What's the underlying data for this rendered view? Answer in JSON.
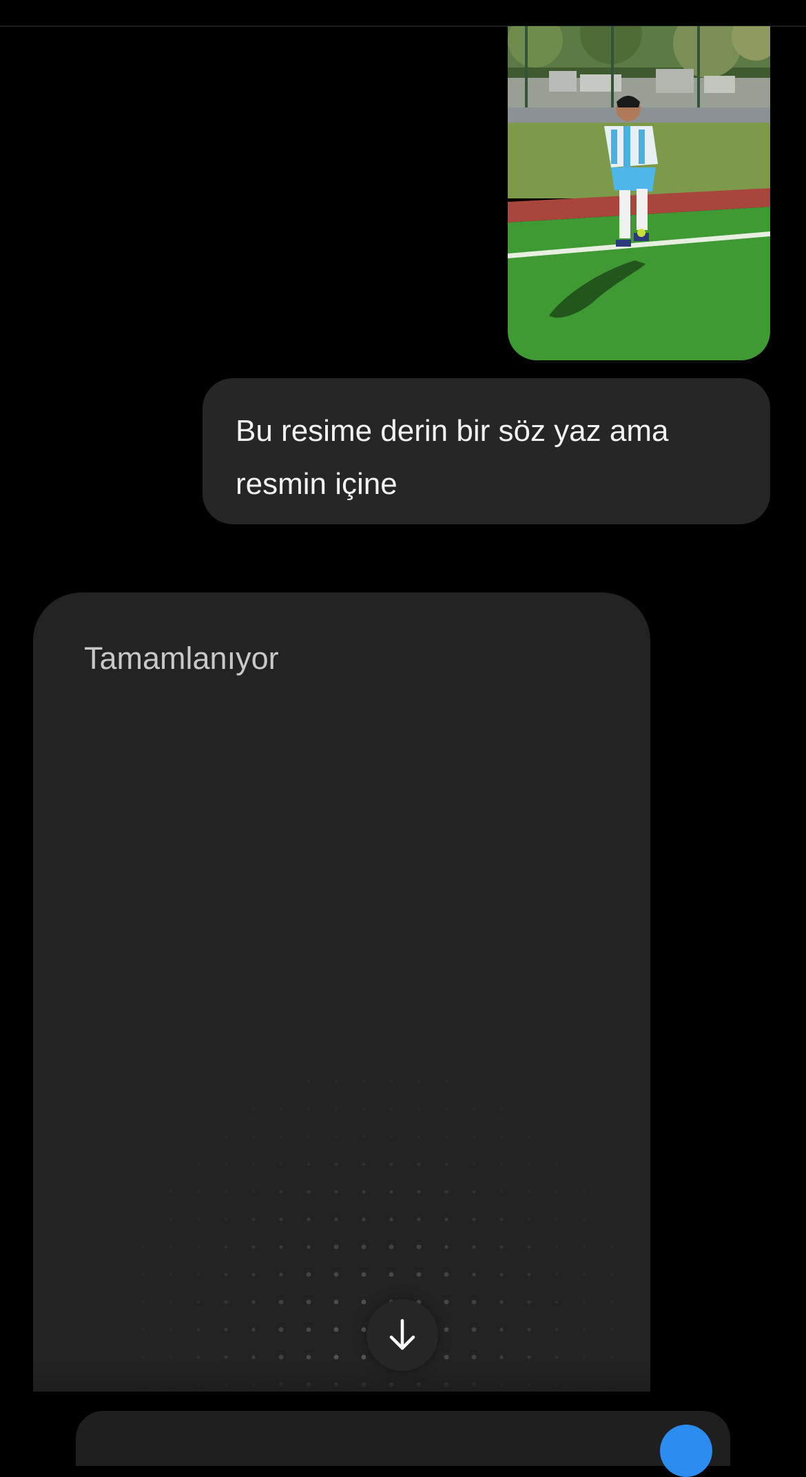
{
  "conversation": {
    "user_photo": {
      "alt_icon": "football-player-photo"
    },
    "user_message": {
      "text_line1": "Bu resime derin bir söz yaz ama",
      "text_line2": "resmin içine"
    },
    "assistant_card": {
      "status": "Tamamlanıyor"
    }
  },
  "controls": {
    "scroll_down_icon": "arrow-down-icon",
    "send_icon": "send-icon"
  },
  "colors": {
    "background": "#000000",
    "bubble": "#262626",
    "card": "#232323",
    "status_text": "#c8c8c8",
    "accent": "#2d8cf0"
  }
}
